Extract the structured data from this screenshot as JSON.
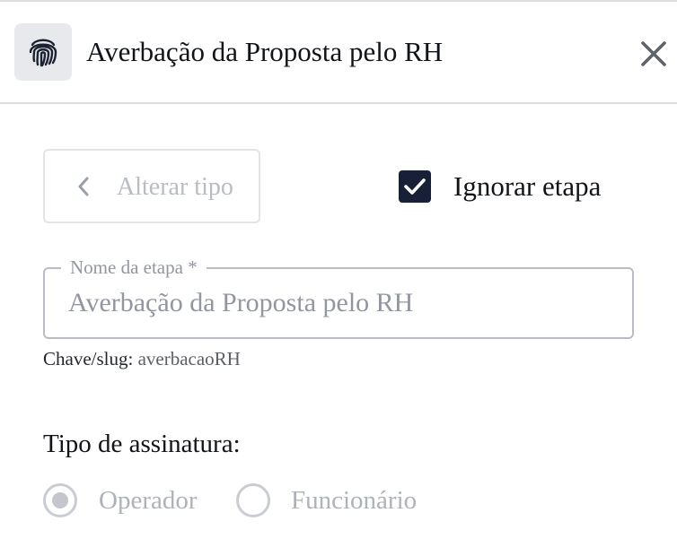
{
  "header": {
    "icon": "fingerprint-icon",
    "title": "Averbação da Proposta pelo RH",
    "close_icon": "close-icon"
  },
  "actions": {
    "alter_type_label": "Alterar tipo",
    "alter_type_icon": "chevron-left-icon",
    "skip_step_label": "Ignorar etapa",
    "skip_step_checked": true
  },
  "step_name": {
    "label": "Nome da etapa *",
    "placeholder": "Averbação da Proposta pelo RH",
    "value": ""
  },
  "slug": {
    "label": "Chave/slug:",
    "value": "averbacaoRH"
  },
  "signature": {
    "heading": "Tipo de assinatura:",
    "options": [
      {
        "label": "Operador",
        "selected": true
      },
      {
        "label": "Funcionário",
        "selected": false
      }
    ]
  },
  "colors": {
    "checkbox_fill": "#172036",
    "border": "#dcdde1",
    "muted_text": "#9196a1"
  }
}
